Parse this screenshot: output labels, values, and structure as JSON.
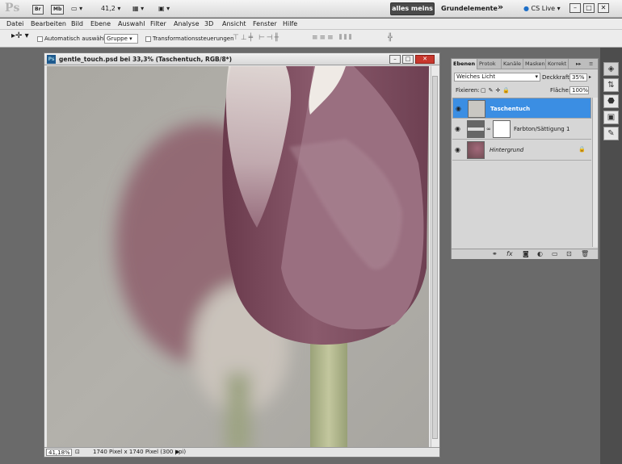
{
  "appbar": {
    "logo": "Ps",
    "bridge": "Br",
    "minibridge": "Mb",
    "zoom": "41,2",
    "workspace_active": "alles meins",
    "workspace_other": "Grundelemente",
    "more": "»",
    "cs_live": "CS Live"
  },
  "menu": [
    "Datei",
    "Bearbeiten",
    "Bild",
    "Ebene",
    "Auswahl",
    "Filter",
    "Analyse",
    "3D",
    "Ansicht",
    "Fenster",
    "Hilfe"
  ],
  "options": {
    "auto_select": "Automatisch auswählen:",
    "auto_select_value": "Gruppe",
    "transform": "Transformationssteuerungen"
  },
  "document": {
    "title": "gentle_touch.psd bei 33,3% (Taschentuch, RGB/8*)",
    "zoom": "41,18%",
    "info": "1740 Pixel x 1740 Pixel (300 ppi)"
  },
  "panel": {
    "tabs": [
      "Ebenen",
      "Protok",
      "Kanäle",
      "Masken",
      "Korrekt"
    ],
    "blend_mode": "Weiches Licht",
    "opacity_label": "Deckkraft:",
    "opacity": "35%",
    "lock_label": "Fixieren:",
    "fill_label": "Fläche:",
    "fill": "100%",
    "layers": [
      {
        "name": "Taschentuch",
        "selected": true
      },
      {
        "name": "Farbton/Sättigung 1",
        "selected": false
      },
      {
        "name": "Hintergrund",
        "selected": false
      }
    ]
  },
  "colors": {
    "selection": "#3b8ee3",
    "background": "#6a6a6a",
    "close": "#c8372d"
  }
}
